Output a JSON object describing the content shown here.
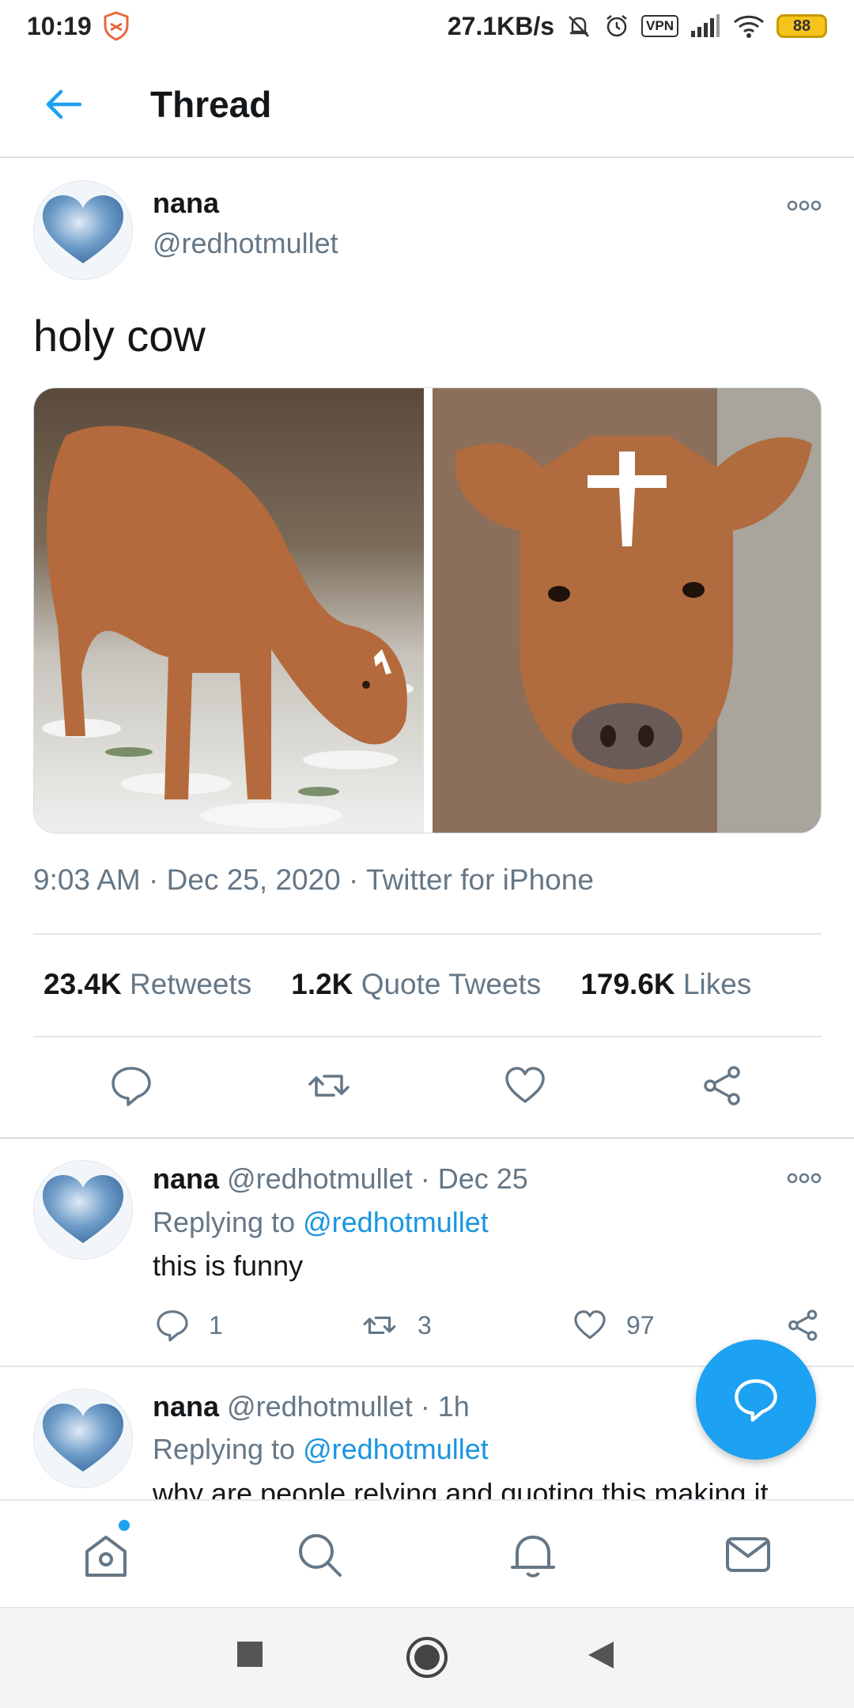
{
  "status_bar": {
    "time": "10:19",
    "net_speed": "27.1KB/s",
    "vpn": "VPN",
    "battery": "88"
  },
  "header": {
    "title": "Thread"
  },
  "main_tweet": {
    "name": "nana",
    "handle": "@redhotmullet",
    "text": "holy cow",
    "time": "9:03 AM",
    "date": "Dec 25, 2020",
    "source": "Twitter for iPhone",
    "retweets_count": "23.4K",
    "retweets_label": "Retweets",
    "quotes_count": "1.2K",
    "quotes_label": "Quote Tweets",
    "likes_count": "179.6K",
    "likes_label": "Likes"
  },
  "replies": [
    {
      "name": "nana",
      "handle": "@redhotmullet",
      "time": "Dec 25",
      "replying_prefix": "Replying to",
      "replying_handle": "@redhotmullet",
      "text": "this is funny",
      "reply_count": "1",
      "retweet_count": "3",
      "like_count": "97"
    },
    {
      "name": "nana",
      "handle": "@redhotmullet",
      "time": "1h",
      "replying_prefix": "Replying to",
      "replying_handle": "@redhotmullet",
      "text": "why are people relying and quoting this making it"
    }
  ],
  "icons": {
    "back": "back-arrow-icon",
    "more": "more-icon",
    "reply": "reply-icon",
    "retweet": "retweet-icon",
    "like": "heart-icon",
    "share": "share-icon",
    "compose": "compose-reply-icon",
    "home": "home-icon",
    "search": "search-icon",
    "notifications": "bell-icon",
    "messages": "mail-icon"
  },
  "colors": {
    "accent": "#1da1f2",
    "link": "#1b95e0",
    "secondary_text": "#657786",
    "primary_text": "#14171a"
  }
}
